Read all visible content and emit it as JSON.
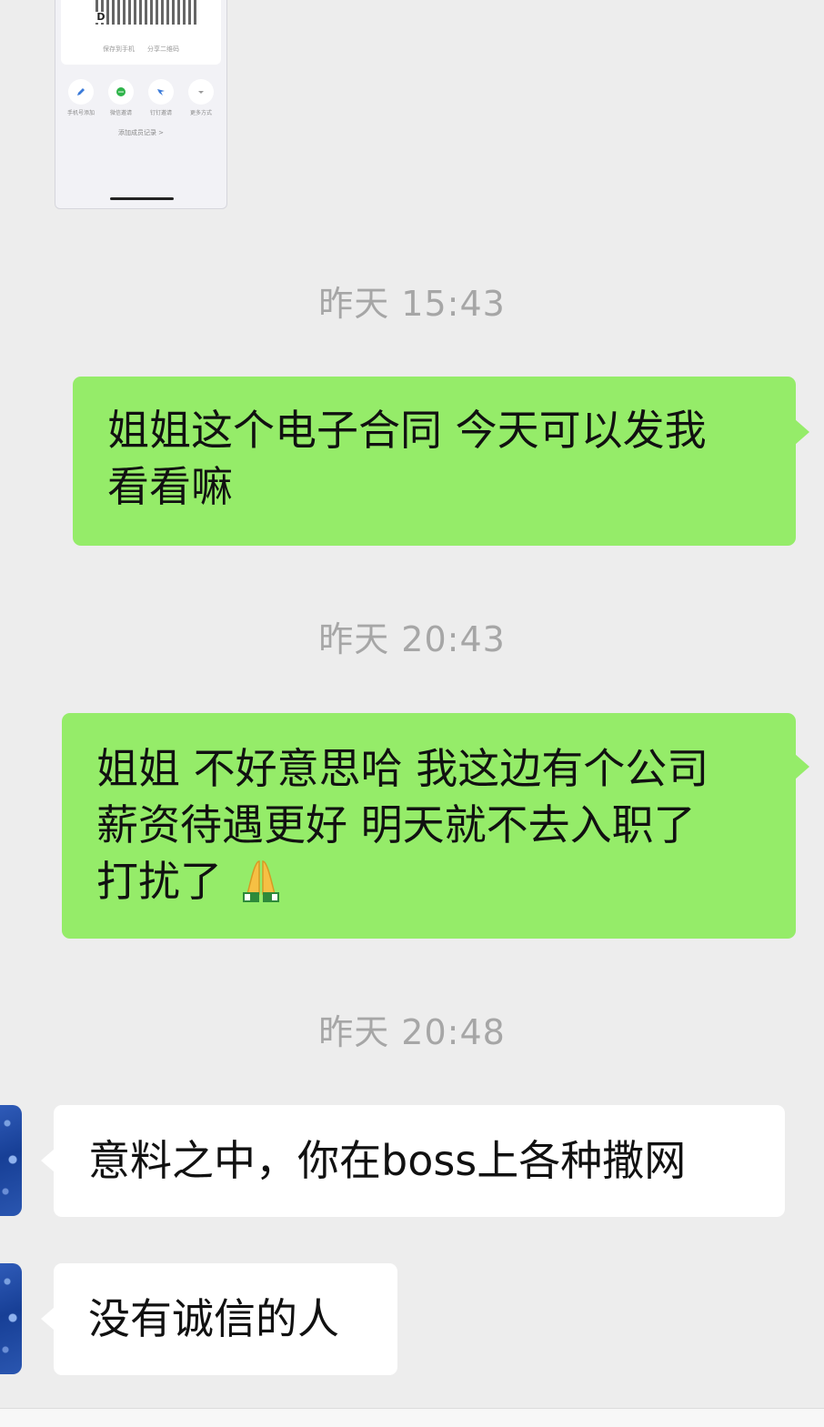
{
  "shared_image": {
    "save_label": "保存到手机",
    "share_label": "分享二维码",
    "options": [
      {
        "icon": "pencil-icon",
        "label": "手机号添加",
        "color": "#3b7bd9"
      },
      {
        "icon": "chat-icon",
        "label": "微信邀请",
        "color": "#2fb44a"
      },
      {
        "icon": "dingtalk-icon",
        "label": "钉钉邀请",
        "color": "#3b7bd9"
      },
      {
        "icon": "more-icon",
        "label": "更多方式",
        "color": "#9a9a9a"
      }
    ],
    "record_link": "添加成员记录 >"
  },
  "messages": [
    {
      "timestamp": "昨天 15:43",
      "direction": "sent",
      "lines": [
        "姐姐这个电子合同 今天可以发我",
        "看看嘛"
      ]
    },
    {
      "timestamp": "昨天 20:43",
      "direction": "sent",
      "lines": [
        "姐姐 不好意思哈 我这边有个公司",
        "薪资待遇更好 明天就不去入职了",
        "打扰了"
      ],
      "emoji": "folded-hands"
    },
    {
      "timestamp": "昨天 20:48",
      "direction": "received",
      "lines": [
        "意料之中，你在boss上各种撒网"
      ]
    },
    {
      "direction": "received",
      "lines": [
        "没有诚信的人"
      ]
    }
  ],
  "colors": {
    "background": "#ededed",
    "sent_bubble": "#95ec69",
    "received_bubble": "#ffffff",
    "timestamp_text": "#a6a6a6"
  }
}
